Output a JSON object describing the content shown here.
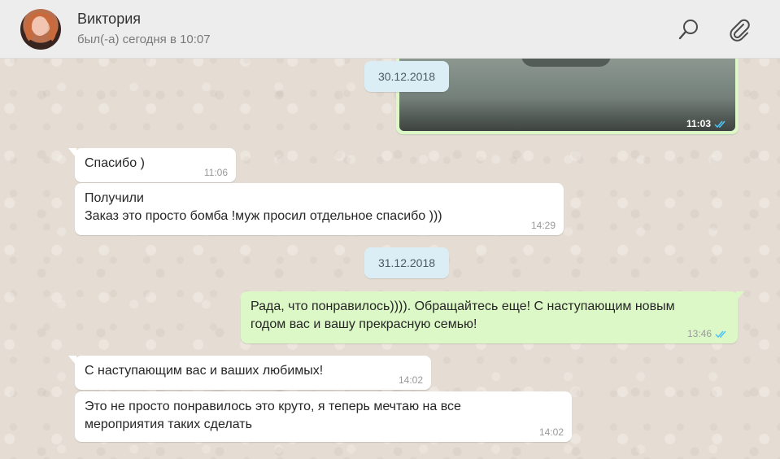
{
  "header": {
    "contact_name": "Виктория",
    "status": "был(-а) сегодня в 10:07",
    "search_icon": "search-icon",
    "attach_icon": "paperclip-icon"
  },
  "colors": {
    "incoming_bubble": "#ffffff",
    "outgoing_bubble": "#dcf8c6",
    "date_pill": "#dbeef6",
    "read_ticks": "#4fc3f7",
    "header_bg": "#ededed"
  },
  "messages": {
    "image_time": "11:03",
    "date1": "30.12.2018",
    "m1": {
      "text": "Спасибо )",
      "time": "11:06"
    },
    "m2": {
      "text": "Получили\nЗаказ это просто бомба !муж просил отдельное спасибо )))",
      "time": "14:29"
    },
    "date2": "31.12.2018",
    "m3": {
      "text": "Рада, что понравилось)))). Обращайтесь еще! С наступающим новым\nгодом вас и вашу прекрасную семью!",
      "time": "13:46"
    },
    "m4": {
      "text": "С наступающим вас и ваших любимых!",
      "time": "14:02"
    },
    "m5": {
      "text": "Это не просто понравилось это круто, я теперь мечтаю  на все\nмероприятия таких сделать",
      "time": "14:02"
    }
  }
}
